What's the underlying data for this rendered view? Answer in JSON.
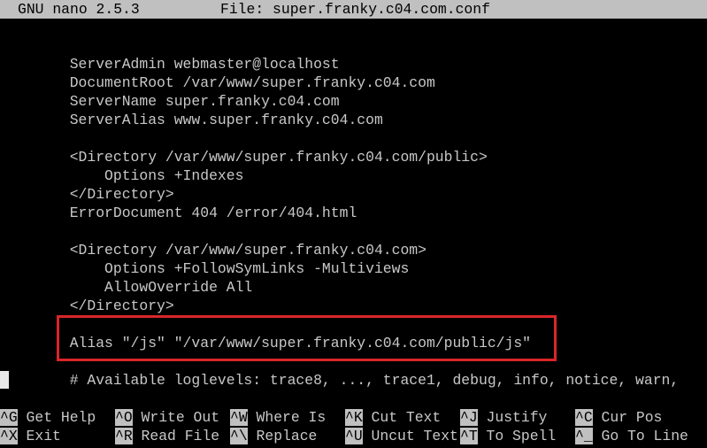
{
  "titlebar": {
    "app": "GNU nano 2.5.3",
    "file": "File: super.franky.c04.com.conf"
  },
  "lines": [
    "        ServerAdmin webmaster@localhost",
    "        DocumentRoot /var/www/super.franky.c04.com",
    "        ServerName super.franky.c04.com",
    "        ServerAlias www.super.franky.c04.com",
    "",
    "        <Directory /var/www/super.franky.c04.com/public>",
    "            Options +Indexes",
    "        </Directory>",
    "        ErrorDocument 404 /error/404.html",
    "",
    "        <Directory /var/www/super.franky.c04.com>",
    "            Options +FollowSymLinks -Multiviews",
    "            AllowOverride All",
    "        </Directory>",
    "",
    "        Alias \"/js\" \"/var/www/super.franky.c04.com/public/js\"",
    "",
    "        # Available loglevels: trace8, ..., trace1, debug, info, notice, warn,"
  ],
  "shortcuts": [
    {
      "key": "^G",
      "label": "Get Help"
    },
    {
      "key": "^O",
      "label": "Write Out"
    },
    {
      "key": "^W",
      "label": "Where Is"
    },
    {
      "key": "^K",
      "label": "Cut Text"
    },
    {
      "key": "^J",
      "label": "Justify"
    },
    {
      "key": "^C",
      "label": "Cur Pos"
    },
    {
      "key": "^X",
      "label": "Exit"
    },
    {
      "key": "^R",
      "label": "Read File"
    },
    {
      "key": "^\\",
      "label": "Replace"
    },
    {
      "key": "^U",
      "label": "Uncut Text"
    },
    {
      "key": "^T",
      "label": "To Spell"
    },
    {
      "key": "^_",
      "label": "Go To Line"
    }
  ],
  "colors": {
    "background": "#000000",
    "text": "#c8c8c8",
    "titlebar": "#c0c0c0",
    "highlight_border": "#d8262a"
  }
}
